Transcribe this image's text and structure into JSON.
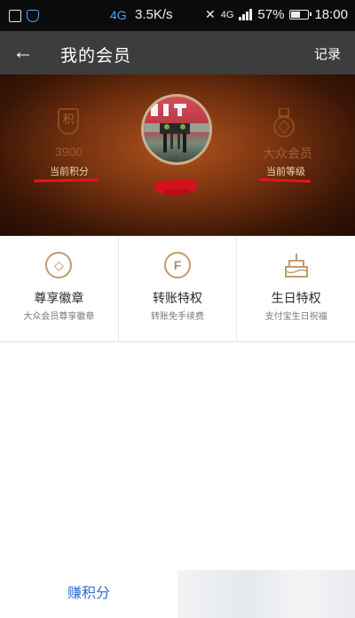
{
  "status_bar": {
    "network": "4G",
    "speed": "3.5K/s",
    "signal_label": "4G",
    "battery": "57%",
    "battery_level": 0.57,
    "time": "18:00"
  },
  "header": {
    "title": "我的会员",
    "record_label": "记录"
  },
  "hero": {
    "points_badge_text": "积",
    "points_value": "3900",
    "points_label": "当前积分",
    "level_value": "大众会员",
    "level_label": "当前等级",
    "accent_color": "#e8131f"
  },
  "privileges": [
    {
      "icon": "badge-icon",
      "glyph": "◇",
      "title": "尊享徽章",
      "subtitle": "大众会员尊享徽章"
    },
    {
      "icon": "transfer-icon",
      "glyph": "F",
      "title": "转账特权",
      "subtitle": "转账免手续费"
    },
    {
      "icon": "cake-icon",
      "glyph": "",
      "title": "生日特权",
      "subtitle": "支付宝生日祝福"
    }
  ],
  "bottom": {
    "earn_points_label": "赚积分",
    "link_color": "#2f6fcf"
  }
}
